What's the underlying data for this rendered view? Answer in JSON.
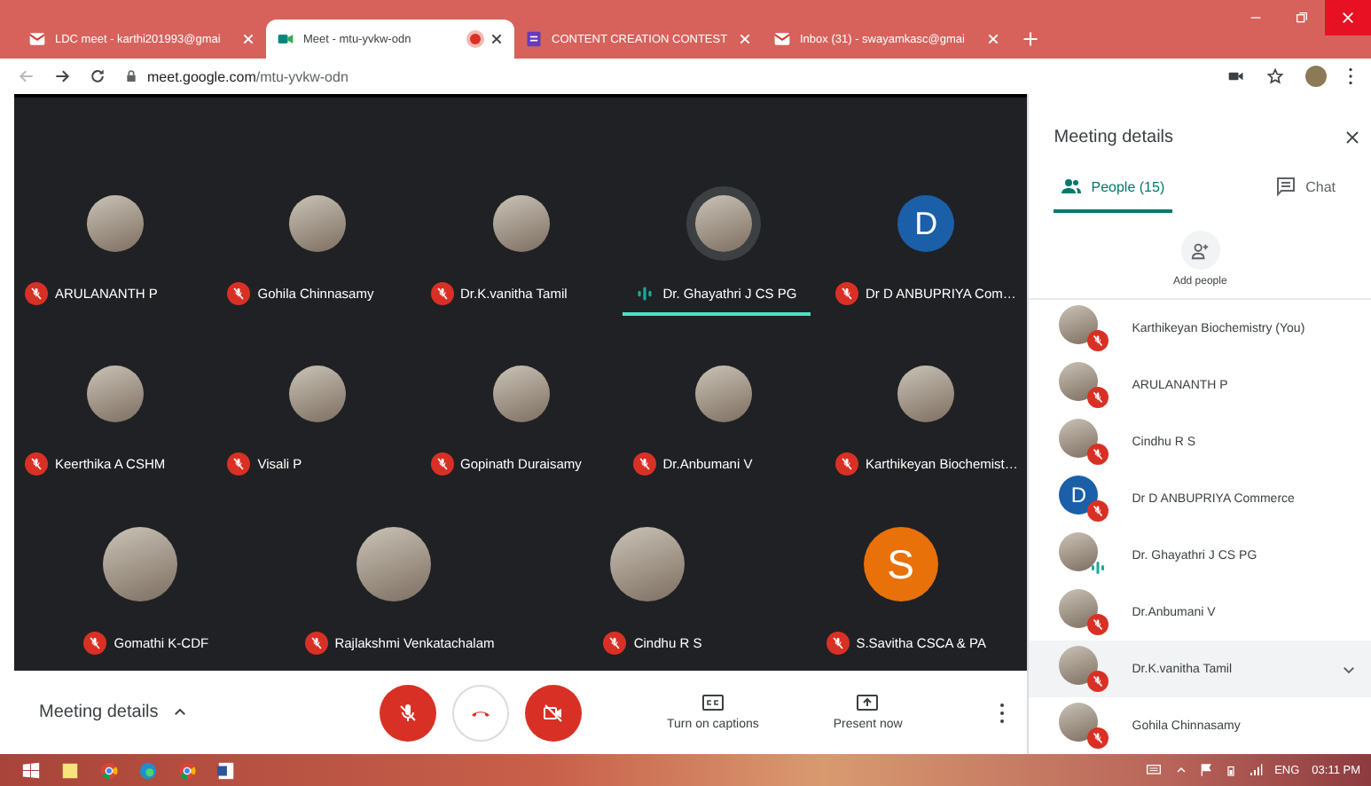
{
  "browser": {
    "tabs": [
      {
        "kind": "mail",
        "title": "LDC meet - karthi201993@gmai",
        "selected": false,
        "recording": false
      },
      {
        "kind": "meet",
        "title": "Meet - mtu-yvkw-odn",
        "selected": true,
        "recording": true
      },
      {
        "kind": "form",
        "title": "CONTENT CREATION CONTEST",
        "selected": false,
        "recording": false
      },
      {
        "kind": "mail",
        "title": "Inbox (31) - swayamkasc@gmai",
        "selected": false,
        "recording": false
      }
    ],
    "url_host": "meet.google.com",
    "url_path": "/mtu-yvkw-odn"
  },
  "grid": {
    "rows": [
      {
        "tiles": [
          {
            "name": "ARULANANTH P",
            "muted": true,
            "speaking": false,
            "avatar": {
              "kind": "photo"
            }
          },
          {
            "name": "Gohila Chinnasamy",
            "muted": true,
            "speaking": false,
            "avatar": {
              "kind": "photo"
            }
          },
          {
            "name": "Dr.K.vanitha Tamil",
            "muted": true,
            "speaking": false,
            "avatar": {
              "kind": "photo"
            }
          },
          {
            "name": "Dr. Ghayathri J CS PG",
            "muted": false,
            "speaking": true,
            "avatar": {
              "kind": "photo"
            }
          },
          {
            "name": "Dr D ANBUPRIYA Com…",
            "muted": true,
            "speaking": false,
            "avatar": {
              "kind": "letter",
              "letter": "D",
              "color": "#1a5fa8"
            }
          }
        ]
      },
      {
        "tiles": [
          {
            "name": "Keerthika A CSHM",
            "muted": true,
            "speaking": false,
            "avatar": {
              "kind": "photo"
            }
          },
          {
            "name": "Visali P",
            "muted": true,
            "speaking": false,
            "avatar": {
              "kind": "photo"
            }
          },
          {
            "name": "Gopinath Duraisamy",
            "muted": true,
            "speaking": false,
            "avatar": {
              "kind": "photo"
            }
          },
          {
            "name": "Dr.Anbumani V",
            "muted": true,
            "speaking": false,
            "avatar": {
              "kind": "photo"
            }
          },
          {
            "name": "Karthikeyan Biochemist…",
            "muted": true,
            "speaking": false,
            "avatar": {
              "kind": "photo"
            }
          }
        ]
      },
      {
        "tiles": [
          {
            "name": "Gomathi K-CDF",
            "muted": true,
            "speaking": false,
            "avatar": {
              "kind": "photo"
            }
          },
          {
            "name": "Rajlakshmi Venkatachalam",
            "muted": true,
            "speaking": false,
            "avatar": {
              "kind": "photo"
            }
          },
          {
            "name": "Cindhu R S",
            "muted": true,
            "speaking": false,
            "avatar": {
              "kind": "photo"
            }
          },
          {
            "name": "S.Savitha CSCA & PA",
            "muted": true,
            "speaking": false,
            "avatar": {
              "kind": "letter",
              "letter": "S",
              "color": "#e8710a"
            }
          }
        ]
      }
    ]
  },
  "controls": {
    "meeting_details": "Meeting details",
    "mic_on": false,
    "camera_on": false,
    "captions": "Turn on captions",
    "present": "Present now"
  },
  "panel": {
    "title": "Meeting details",
    "tabs": [
      {
        "kind": "people",
        "label": "People (15)",
        "selected": true
      },
      {
        "kind": "chat",
        "label": "Chat",
        "selected": false
      }
    ],
    "add_people": "Add people",
    "people": [
      {
        "name": "Karthikeyan Biochemistry (You)",
        "muted": true,
        "highlighted": false,
        "avatar": {
          "kind": "photo"
        }
      },
      {
        "name": "ARULANANTH P",
        "muted": true,
        "highlighted": false,
        "avatar": {
          "kind": "photo"
        }
      },
      {
        "name": "Cindhu R S",
        "muted": true,
        "highlighted": false,
        "avatar": {
          "kind": "photo"
        }
      },
      {
        "name": "Dr D ANBUPRIYA Commerce",
        "muted": true,
        "highlighted": false,
        "avatar": {
          "kind": "letter",
          "letter": "D",
          "color": "#1a5fa8"
        }
      },
      {
        "name": "Dr. Ghayathri J CS PG",
        "muted": false,
        "highlighted": false,
        "avatar": {
          "kind": "photo"
        }
      },
      {
        "name": "Dr.Anbumani V",
        "muted": true,
        "highlighted": false,
        "avatar": {
          "kind": "photo"
        }
      },
      {
        "name": "Dr.K.vanitha Tamil",
        "muted": true,
        "highlighted": true,
        "avatar": {
          "kind": "photo"
        }
      },
      {
        "name": "Gohila Chinnasamy",
        "muted": true,
        "highlighted": false,
        "avatar": {
          "kind": "photo"
        }
      }
    ]
  },
  "taskbar": {
    "language": "ENG",
    "time": "03:11 PM"
  }
}
